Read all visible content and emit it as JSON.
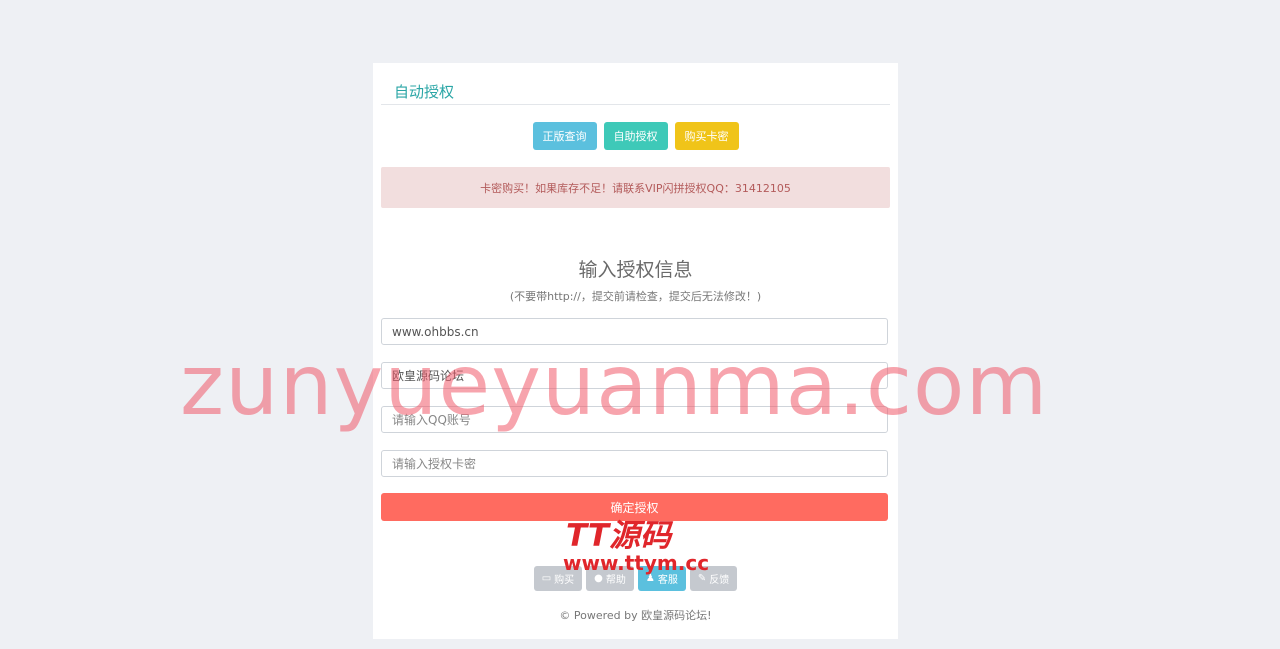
{
  "card": {
    "title": "自动授权",
    "top_buttons": [
      {
        "label": "正版查询"
      },
      {
        "label": "自助授权"
      },
      {
        "label": "购买卡密"
      }
    ],
    "alert_text": "卡密购买！如果库存不足！请联系VIP闪拼授权QQ：31412105",
    "form_title": "输入授权信息",
    "form_hint": "(不要带http://，提交前请检查，提交后无法修改！)",
    "fields": {
      "domain_value": "www.ohbbs.cn",
      "site_name_value": "欧皇源码论坛",
      "qq_placeholder": "请输入QQ账号",
      "card_placeholder": "请输入授权卡密"
    },
    "submit_label": "确定授权",
    "bottom_buttons": [
      {
        "label": "购买",
        "icon": "card-icon"
      },
      {
        "label": "帮助",
        "icon": "info-icon"
      },
      {
        "label": "客服",
        "icon": "user-icon"
      },
      {
        "label": "反馈",
        "icon": "pencil-icon"
      }
    ],
    "footer": "© Powered by 欧皇源码论坛!"
  },
  "watermarks": {
    "big": "zunyueyuanma.com",
    "logo": "TT源码",
    "url": "www.ttym.cc"
  },
  "colors": {
    "accent": "#2aa6a6",
    "info": "#5bc0de",
    "success": "#3ec9b8",
    "warning": "#f0c419",
    "danger_button": "#ff6b60",
    "alert_bg": "#f2dede"
  }
}
